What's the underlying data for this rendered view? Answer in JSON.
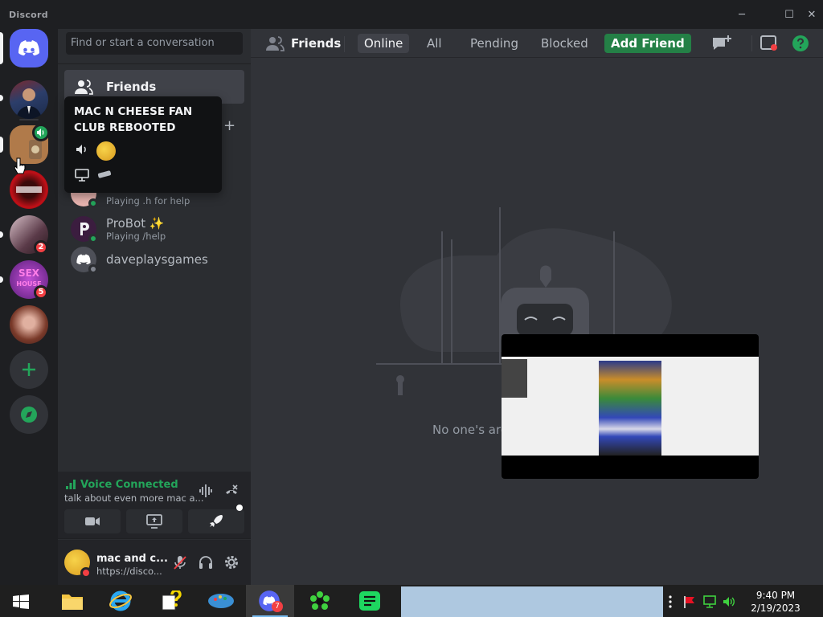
{
  "window": {
    "brand": "Discord",
    "controls": [
      "─",
      "☐",
      "✕"
    ]
  },
  "rail": {
    "servers": [
      {
        "label": "Discord home",
        "color": "#5865f2"
      },
      {
        "label": "server-portrait",
        "color": "#3c5a8a"
      },
      {
        "label": "MAC N CHEESE FAN CLUB REBOOTED",
        "color": "#b07a4a"
      },
      {
        "label": "server-red",
        "color": "#b3121b"
      },
      {
        "label": "server-photo",
        "color": "#6b4b5a",
        "badge": "2"
      },
      {
        "label": "SEX HOUSE",
        "color": "#7a2d8c",
        "badge": "5"
      },
      {
        "label": "server-girl",
        "color": "#8b4a3a"
      }
    ],
    "sex_text": "SEX",
    "house_text": "HOUSE"
  },
  "sidebar": {
    "search_placeholder": "Find or start a conversation",
    "friends_label": "Friends",
    "dm_add": "+",
    "dms": [
      {
        "name": "",
        "sub": "Playing .h for help",
        "avatar": "#e8b4b0",
        "status": "#23a55a"
      },
      {
        "name": "ProBot ✨",
        "sub": "Playing /help",
        "avatar": "#3b1d3f",
        "status": "#23a55a"
      },
      {
        "name": "daveplaysgames",
        "sub": "",
        "avatar": "#5865f2",
        "status": "#80848e"
      }
    ],
    "tooltip": {
      "title": "MAC N CHEESE FAN CLUB REBOOTED"
    },
    "voice": {
      "status": "Voice Connected",
      "channel": "talk about even more mac a..."
    },
    "user": {
      "name": "mac and c...",
      "status": "https://disco..."
    }
  },
  "main": {
    "header_title": "Friends",
    "tabs": [
      "Online",
      "All",
      "Pending",
      "Blocked"
    ],
    "add_friend": "Add Friend",
    "empty_text": "No one's aro"
  },
  "taskbar": {
    "time": "9:40 PM",
    "date": "2/19/2023",
    "discord_badge": "7"
  },
  "colors": {
    "accent": "#5865f2",
    "green": "#23a55a",
    "red": "#f23f43"
  }
}
